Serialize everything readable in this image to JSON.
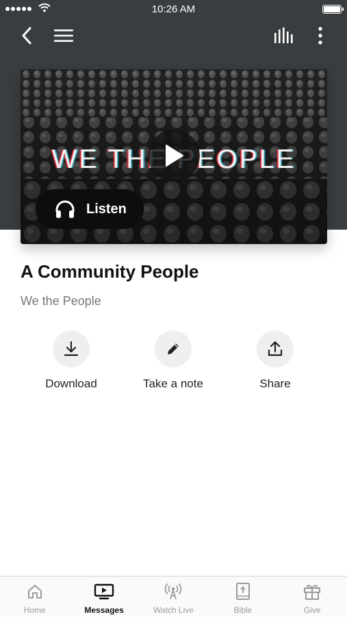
{
  "status_bar": {
    "time": "10:26 AM"
  },
  "media": {
    "card_title": "WE THE PEOPLE",
    "listen_label": "Listen"
  },
  "sermon": {
    "title": "A Community People",
    "series": "We the People"
  },
  "actions": [
    {
      "label": "Download",
      "icon": "download-icon"
    },
    {
      "label": "Take a note",
      "icon": "pencil-icon"
    },
    {
      "label": "Share",
      "icon": "share-icon"
    }
  ],
  "tabs": [
    {
      "label": "Home",
      "icon": "home-icon",
      "active": false
    },
    {
      "label": "Messages",
      "icon": "messages-tv-icon",
      "active": true
    },
    {
      "label": "Watch Live",
      "icon": "broadcast-icon",
      "active": false
    },
    {
      "label": "Bible",
      "icon": "bible-icon",
      "active": false
    },
    {
      "label": "Give",
      "icon": "gift-icon",
      "active": false
    }
  ],
  "colors": {
    "header_bg": "#3a3d3f",
    "accent": "#111111",
    "inactive_tab": "#9a9a9a"
  }
}
